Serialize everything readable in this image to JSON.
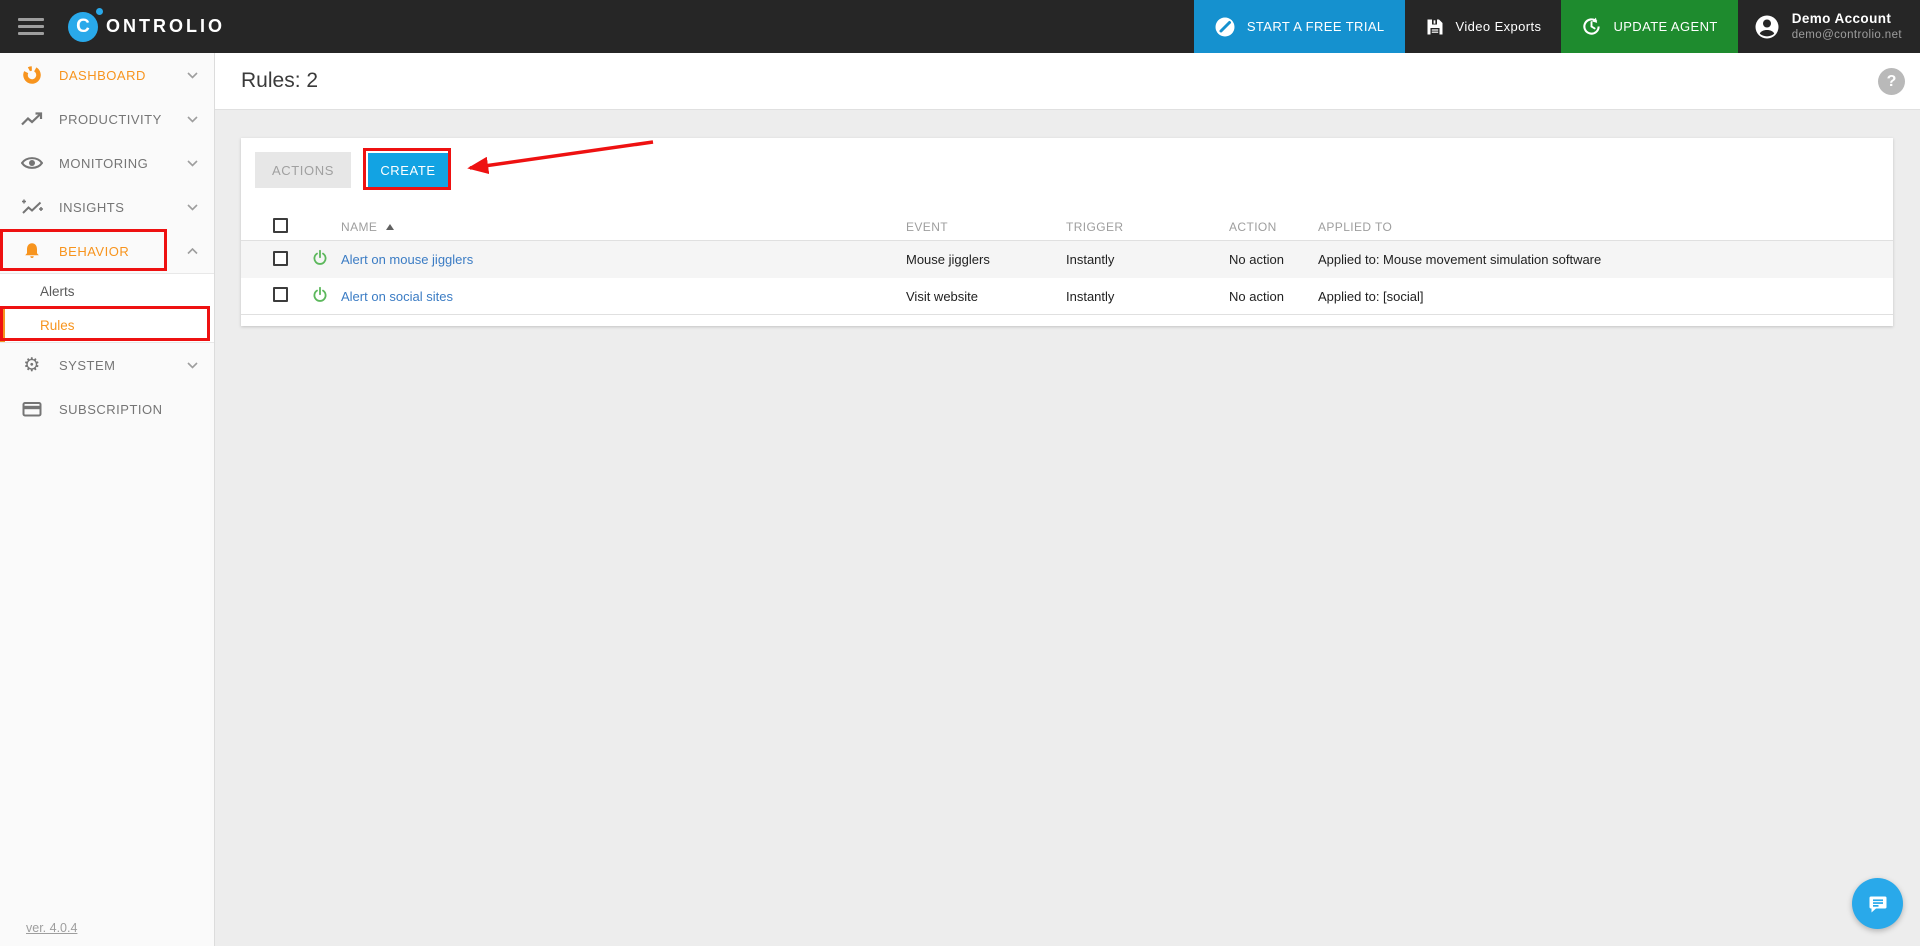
{
  "colors": {
    "topbar_bg": "#262626",
    "brand_blue": "#29a9ea",
    "trial_blue": "#1591cf",
    "create_blue": "#12a3e3",
    "update_green": "#1e8b2e",
    "accent_orange": "#f7941e",
    "link_blue": "#3b7cc4",
    "power_green": "#5cb85c",
    "annotation_red": "#ee1111",
    "chat_blue": "#29a9ea"
  },
  "topbar": {
    "logo_letter": "C",
    "logo_text": "ONTROLIO",
    "trial_label": "START A FREE TRIAL",
    "video_exports_label": "Video Exports",
    "update_agent_label": "UPDATE AGENT",
    "account_name": "Demo Account",
    "account_email": "demo@controlio.net"
  },
  "sidebar": {
    "items": [
      {
        "label": "DASHBOARD"
      },
      {
        "label": "PRODUCTIVITY"
      },
      {
        "label": "MONITORING"
      },
      {
        "label": "INSIGHTS"
      },
      {
        "label": "BEHAVIOR"
      },
      {
        "label": "SYSTEM"
      },
      {
        "label": "SUBSCRIPTION"
      }
    ],
    "behavior_submenu": [
      {
        "label": "Alerts"
      },
      {
        "label": "Rules"
      }
    ],
    "version_label": "ver. 4.0.4"
  },
  "page": {
    "title": "Rules: 2",
    "help_glyph": "?"
  },
  "toolbar": {
    "actions_label": "ACTIONS",
    "create_label": "CREATE"
  },
  "table": {
    "headers": {
      "name": "NAME",
      "event": "EVENT",
      "trigger": "TRIGGER",
      "action": "ACTION",
      "applied_to": "APPLIED TO"
    },
    "sort": {
      "column": "NAME",
      "direction": "asc"
    },
    "rows": [
      {
        "name": "Alert on mouse jigglers",
        "event": "Mouse jigglers",
        "trigger": "Instantly",
        "action": "No action",
        "applied_to": "Applied to: Mouse movement simulation software",
        "enabled": true
      },
      {
        "name": "Alert on social sites",
        "event": "Visit website",
        "trigger": "Instantly",
        "action": "No action",
        "applied_to": "Applied to: [social]",
        "enabled": true
      }
    ]
  }
}
